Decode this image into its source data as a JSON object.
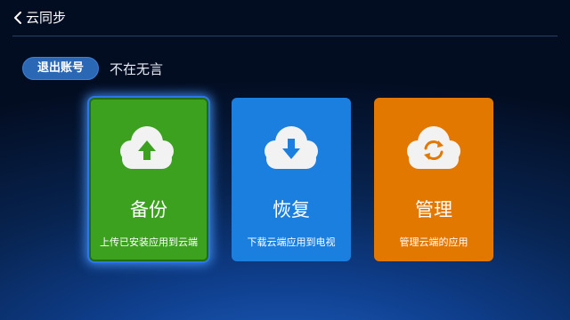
{
  "header": {
    "back_icon": "chevron-left-icon",
    "title": "云同步"
  },
  "account": {
    "logout_label": "退出账号",
    "username": "不在无言"
  },
  "cards": [
    {
      "id": "backup",
      "icon": "cloud-upload-icon",
      "title": "备份",
      "subtitle": "上传已安装应用到云端",
      "color": "#3ba11f",
      "focused": true
    },
    {
      "id": "restore",
      "icon": "cloud-download-icon",
      "title": "恢复",
      "subtitle": "下载云端应用到电视",
      "color": "#1a7fde",
      "focused": false
    },
    {
      "id": "manage",
      "icon": "cloud-sync-icon",
      "title": "管理",
      "subtitle": "管理云端的应用",
      "color": "#e37800",
      "focused": false
    }
  ],
  "colors": {
    "background": "#07234f",
    "focus_glow": "#2c76e8",
    "icon_cloud": "#f2f2f2"
  }
}
